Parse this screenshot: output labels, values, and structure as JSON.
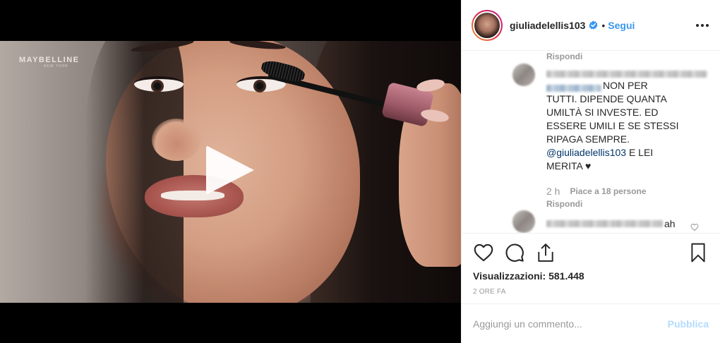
{
  "media": {
    "brand": "MAYBELLINE",
    "brand_sub": "NEW YORK"
  },
  "header": {
    "username": "giuliadelellis103",
    "separator": "•",
    "follow_label": "Segui"
  },
  "comments": {
    "reply_label_top": "Rispondi",
    "comment_lines": {
      "line1": "NON PER",
      "line2": "TUTTI. DIPENDE QUANTA",
      "line3": "UMILTÀ SI INVESTE. ED",
      "line4": "ESSERE UMILI E SE STESSI",
      "line5": "RIPAGA SEMPRE.",
      "mention": "@giuliadelellis103",
      "line6_after_mention": " E LEI",
      "line7": "MERITA ♥"
    },
    "time": "2 h",
    "likes": "Piace a 18 persone",
    "reply_label": "Rispondi",
    "second_comment_tail": "ah"
  },
  "actions": {
    "views": "Visualizzazioni: 581.448",
    "ago": "2 ORE FA"
  },
  "add_comment": {
    "placeholder": "Aggiungi un commento...",
    "publish_label": "Pubblica"
  },
  "colors": {
    "link": "#3897f0",
    "mention": "#003569",
    "muted": "#999999",
    "publish_disabled": "#b3dbff"
  }
}
